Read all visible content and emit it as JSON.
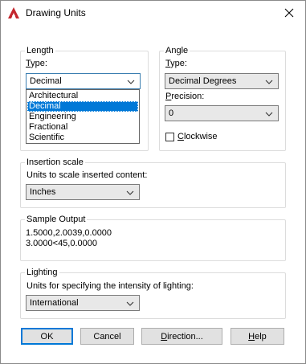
{
  "window": {
    "title": "Drawing Units",
    "icon": "autocad-icon",
    "close_icon": "close-icon"
  },
  "length": {
    "group_label": "Length",
    "type_label_u": "T",
    "type_label_rest": "ype:",
    "type_value": "Decimal",
    "options": [
      "Architectural",
      "Decimal",
      "Engineering",
      "Fractional",
      "Scientific"
    ],
    "selected_option": "Decimal"
  },
  "angle": {
    "group_label": "Angle",
    "type_label_u": "T",
    "type_label_rest": "ype:",
    "type_value": "Decimal Degrees",
    "precision_label_u": "P",
    "precision_label_rest": "recision:",
    "precision_value": "0",
    "clockwise_label_u": "C",
    "clockwise_label_rest": "lockwise",
    "clockwise_checked": false
  },
  "insertion": {
    "group_label": "Insertion scale",
    "desc": "Units to scale inserted content:",
    "value": "Inches"
  },
  "sample": {
    "group_label": "Sample Output",
    "line1": "1.5000,2.0039,0.0000",
    "line2": "3.0000<45,0.0000"
  },
  "lighting": {
    "group_label": "Lighting",
    "desc": "Units for specifying the intensity of lighting:",
    "value": "International"
  },
  "buttons": {
    "ok": "OK",
    "cancel": "Cancel",
    "direction_u": "D",
    "direction_rest": "irection...",
    "help_u": "H",
    "help_rest": "elp"
  },
  "colors": {
    "selection": "#0078d7",
    "icon_red": "#c4262e"
  }
}
